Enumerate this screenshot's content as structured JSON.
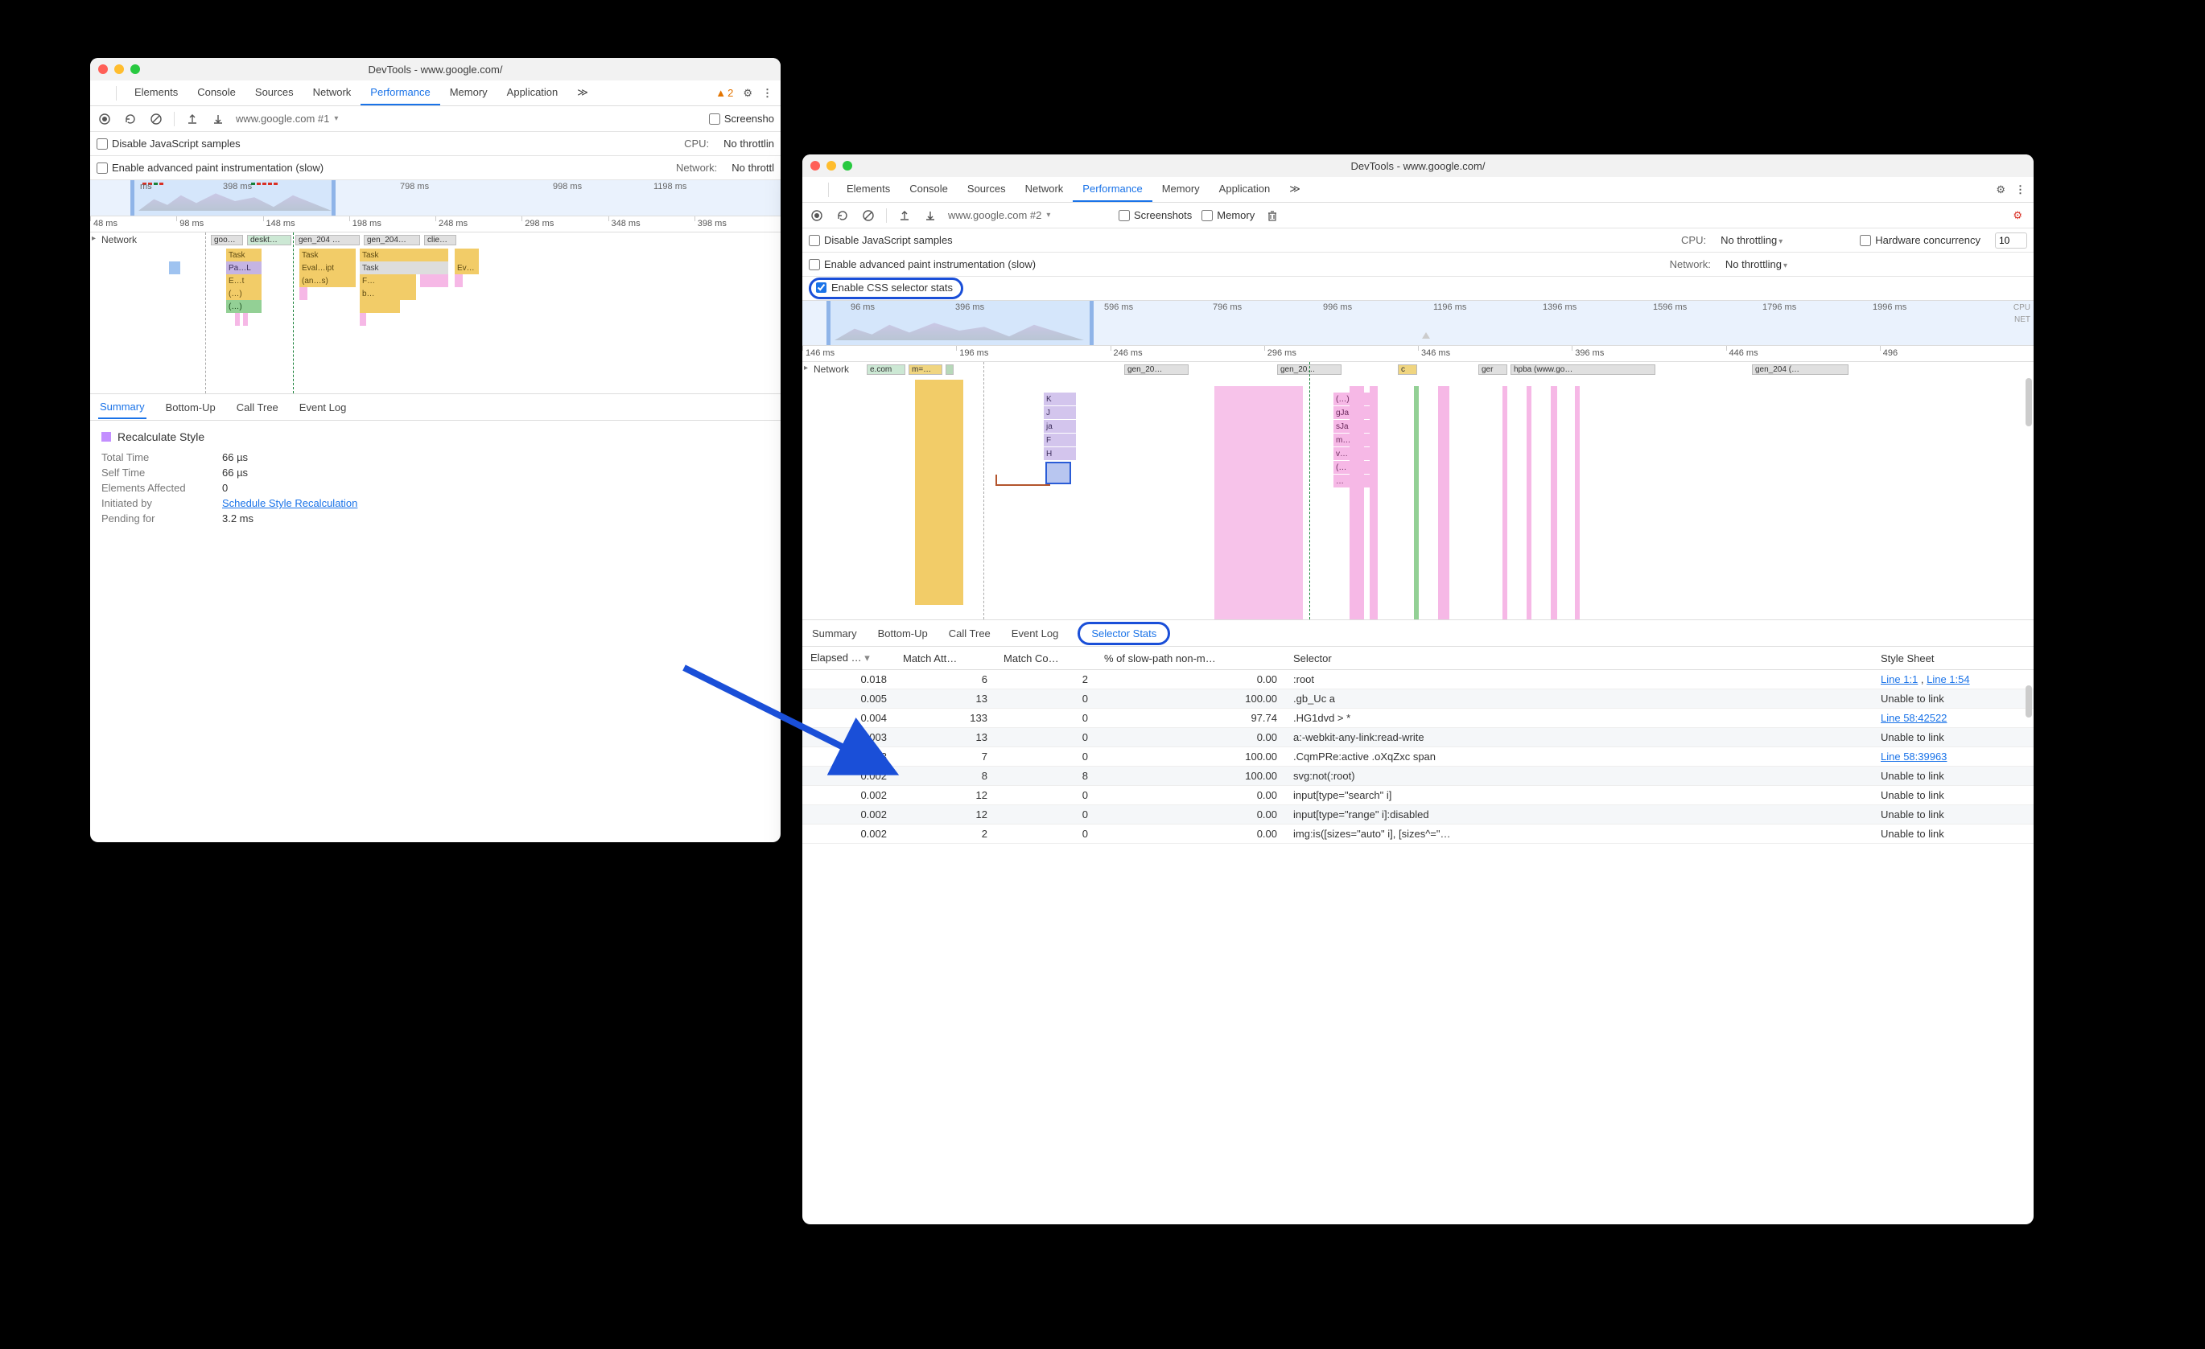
{
  "win1": {
    "title": "DevTools - www.google.com/",
    "tabs": [
      "Elements",
      "Console",
      "Sources",
      "Network",
      "Performance",
      "Memory",
      "Application"
    ],
    "active_tab": "Performance",
    "warn_count": "2",
    "rec_label": "www.google.com #1",
    "chk_screenshots": "Screensho",
    "opt_disable_js": "Disable JavaScript samples",
    "opt_cpu_k": "CPU:",
    "opt_cpu_v": "No throttlin",
    "opt_paint": "Enable advanced paint instrumentation (slow)",
    "opt_net_k": "Network:",
    "opt_net_v": "No throttl",
    "mm_labels": [
      "ms",
      "398 ms",
      "798 ms",
      "998 ms",
      "1198 ms"
    ],
    "ruler": [
      "48 ms",
      "98 ms",
      "148 ms",
      "198 ms",
      "248 ms",
      "298 ms",
      "348 ms",
      "398 ms"
    ],
    "net_track": "Network",
    "net_items": [
      "goo…",
      "deskt…",
      "gen_204 …",
      "gen_204…",
      "clie…"
    ],
    "fcells": {
      "task": "Task",
      "pa": "Pa…L",
      "et": "E…t",
      "dots": "(…)",
      "eval": "Eval…ipt",
      "ans": "(an…s)",
      "f": "F…",
      "b": "b…",
      "ev": "Ev…"
    },
    "dtabs": [
      "Summary",
      "Bottom-Up",
      "Call Tree",
      "Event Log"
    ],
    "active_dtab": "Summary",
    "sum_title": "Recalculate Style",
    "rows": [
      {
        "k": "Total Time",
        "v": "66 µs"
      },
      {
        "k": "Self Time",
        "v": "66 µs"
      },
      {
        "k": "Elements Affected",
        "v": "0"
      },
      {
        "k": "Initiated by",
        "link": "Schedule Style Recalculation"
      },
      {
        "k": "Pending for",
        "v": "3.2 ms"
      }
    ]
  },
  "win2": {
    "title": "DevTools - www.google.com/",
    "tabs": [
      "Elements",
      "Console",
      "Sources",
      "Network",
      "Performance",
      "Memory",
      "Application"
    ],
    "active_tab": "Performance",
    "rec_label": "www.google.com #2",
    "chk_screenshots": "Screenshots",
    "chk_memory": "Memory",
    "opt_disable_js": "Disable JavaScript samples",
    "opt_cpu_k": "CPU:",
    "opt_cpu_v": "No throttling",
    "opt_hc": "Hardware concurrency",
    "opt_hc_v": "10",
    "opt_paint": "Enable advanced paint instrumentation (slow)",
    "opt_net_k": "Network:",
    "opt_net_v": "No throttling",
    "opt_css": "Enable CSS selector stats",
    "mm_labels": [
      "96 ms",
      "396 ms",
      "596 ms",
      "796 ms",
      "996 ms",
      "1196 ms",
      "1396 ms",
      "1596 ms",
      "1796 ms",
      "1996 ms"
    ],
    "mm_cpu": "CPU",
    "mm_net": "NET",
    "ruler": [
      "146 ms",
      "196 ms",
      "246 ms",
      "296 ms",
      "346 ms",
      "396 ms",
      "446 ms",
      "496"
    ],
    "net_track": "Network",
    "net_items": [
      "e.com",
      "m=…",
      "gen_20…",
      "gen_20…",
      "c",
      "ger",
      "hpba (www.go…",
      "gen_204 (…"
    ],
    "stack": [
      "K",
      "J",
      "ja",
      "F",
      "H"
    ],
    "stack2": [
      "(…)",
      "gJa",
      "sJa",
      "m…",
      "v…",
      "(…",
      "…"
    ],
    "dtabs": [
      "Summary",
      "Bottom-Up",
      "Call Tree",
      "Event Log",
      "Selector Stats"
    ],
    "active_dtab": "Selector Stats",
    "cols": [
      "Elapsed …",
      "Match Att…",
      "Match Co…",
      "% of slow-path non-m…",
      "Selector",
      "Style Sheet"
    ],
    "rows": [
      {
        "e": "0.018",
        "a": "6",
        "c": "2",
        "p": "0.00",
        "sel": ":root",
        "sheet_link": "Line 1:1",
        "sheet_sep": " , ",
        "sheet_link2": "Line 1:54"
      },
      {
        "e": "0.005",
        "a": "13",
        "c": "0",
        "p": "100.00",
        "sel": ".gb_Uc a",
        "sheet": "Unable to link"
      },
      {
        "e": "0.004",
        "a": "133",
        "c": "0",
        "p": "97.74",
        "sel": ".HG1dvd > *",
        "sheet_link": "Line 58:42522"
      },
      {
        "e": "0.003",
        "a": "13",
        "c": "0",
        "p": "0.00",
        "sel": "a:-webkit-any-link:read-write",
        "sheet": "Unable to link"
      },
      {
        "e": "0.003",
        "a": "7",
        "c": "0",
        "p": "100.00",
        "sel": ".CqmPRe:active .oXqZxc span",
        "sheet_link": "Line 58:39963"
      },
      {
        "e": "0.002",
        "a": "8",
        "c": "8",
        "p": "100.00",
        "sel": "svg:not(:root)",
        "sheet": "Unable to link"
      },
      {
        "e": "0.002",
        "a": "12",
        "c": "0",
        "p": "0.00",
        "sel": "input[type=\"search\" i]",
        "sheet": "Unable to link"
      },
      {
        "e": "0.002",
        "a": "12",
        "c": "0",
        "p": "0.00",
        "sel": "input[type=\"range\" i]:disabled",
        "sheet": "Unable to link"
      },
      {
        "e": "0.002",
        "a": "2",
        "c": "0",
        "p": "0.00",
        "sel": "img:is([sizes=\"auto\" i], [sizes^=\"…",
        "sheet": "Unable to link"
      }
    ]
  }
}
